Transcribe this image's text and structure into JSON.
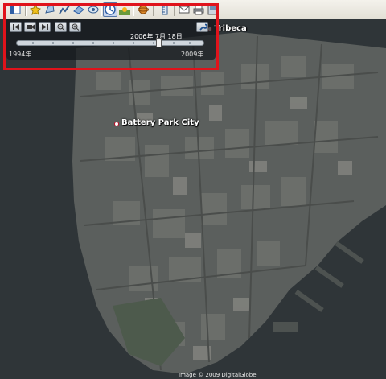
{
  "map": {
    "imagery": "satellite-lower-manhattan"
  },
  "toolbar": {
    "buttons": [
      {
        "name": "sidebar-toggle",
        "icon": "sidebar-icon"
      },
      {
        "name": "add-placemark",
        "icon": "placemark-icon"
      },
      {
        "name": "add-polygon",
        "icon": "polygon-icon"
      },
      {
        "name": "add-path",
        "icon": "path-icon"
      },
      {
        "name": "image-overlay",
        "icon": "image-overlay-icon"
      },
      {
        "name": "record-tour",
        "icon": "record-tour-icon"
      },
      {
        "name": "historical-imagery",
        "icon": "clock-icon",
        "active": true
      },
      {
        "name": "sunlight",
        "icon": "sun-icon"
      },
      {
        "name": "switch-to-sky",
        "icon": "planet-icon"
      },
      {
        "name": "ruler",
        "icon": "ruler-icon"
      },
      {
        "name": "email",
        "icon": "email-icon"
      },
      {
        "name": "print",
        "icon": "print-icon"
      },
      {
        "name": "save-image",
        "icon": "save-image-icon"
      }
    ]
  },
  "time_slider": {
    "current_date": "2006年 7月 18日",
    "start_label": "1994年",
    "end_label": "2009年",
    "position_fraction": 0.8
  },
  "places": [
    {
      "id": "tribeca",
      "label": "Tribeca"
    },
    {
      "id": "battery-park-city",
      "label": "Battery Park City"
    }
  ],
  "copyright": "Image © 2009 DigitalGlobe",
  "colors": {
    "highlight": "#e0131b",
    "water": "#2f3538",
    "active_button": "#c8d6ee"
  }
}
